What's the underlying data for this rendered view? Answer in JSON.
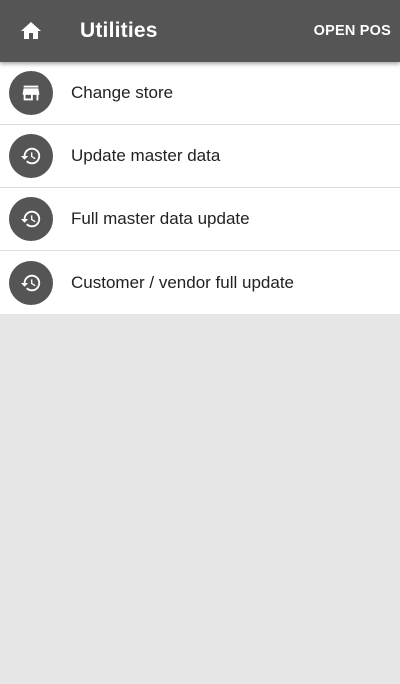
{
  "app_bar": {
    "title": "Utilities",
    "home_icon": "home-icon",
    "action_label": "OPEN POS",
    "background": "#555555"
  },
  "menu": {
    "items": [
      {
        "label": "Change store",
        "icon": "store-icon"
      },
      {
        "label": "Update master data",
        "icon": "history-icon"
      },
      {
        "label": "Full master data update",
        "icon": "history-icon"
      },
      {
        "label": "Customer / vendor full update",
        "icon": "history-icon"
      }
    ]
  },
  "colors": {
    "icon_circle": "#555555",
    "list_background": "#ffffff",
    "page_background": "#e6e6e6"
  }
}
